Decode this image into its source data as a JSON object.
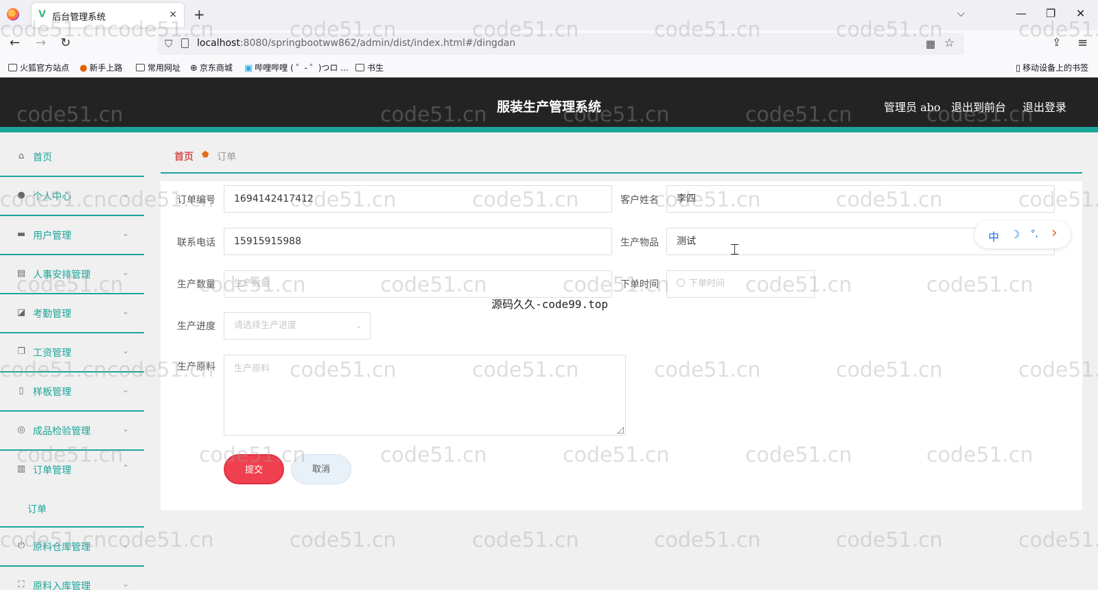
{
  "browser": {
    "tab_title": "后台管理系统",
    "tab_close": "×",
    "new_tab": "+",
    "url_host": "localhost",
    "url_rest": ":8080/springbootww862/admin/dist/index.html#/dingdan",
    "bookmarks": [
      "火狐官方站点",
      "新手上路",
      "常用网址",
      "京东商城",
      "哔哩哔哩 ( ゜- ゜)つロ ...",
      "书生"
    ],
    "mobile_bookmarks": "移动设备上的书签"
  },
  "header": {
    "title": "服装生产管理系统",
    "user": "管理员 abo",
    "to_front": "退出到前台",
    "logout": "退出登录"
  },
  "sidebar": {
    "items": [
      {
        "label": "首页",
        "icon": "home-icon"
      },
      {
        "label": "个人中心",
        "icon": "user-icon"
      },
      {
        "label": "用户管理",
        "icon": "briefcase-icon"
      },
      {
        "label": "人事安排管理",
        "icon": "clipboard-icon"
      },
      {
        "label": "考勤管理",
        "icon": "chart-icon"
      },
      {
        "label": "工资管理",
        "icon": "copy-icon"
      },
      {
        "label": "样板管理",
        "icon": "phone-icon"
      },
      {
        "label": "成品检验管理",
        "icon": "compass-icon"
      },
      {
        "label": "订单管理",
        "icon": "book-icon"
      },
      {
        "label": "原料仓库管理",
        "icon": "power-icon"
      },
      {
        "label": "原料入库管理",
        "icon": "fullscreen-icon"
      }
    ],
    "sub_item": "订单"
  },
  "breadcrumb": {
    "home": "首页",
    "current": "订单"
  },
  "form": {
    "order_no_label": "订单编号",
    "order_no_value": "1694142417412",
    "customer_label": "客户姓名",
    "customer_value": "李四",
    "phone_label": "联系电话",
    "phone_value": "15915915988",
    "goods_label": "生产物品",
    "goods_value": "测试",
    "quantity_label": "生产数量",
    "quantity_placeholder": "生产数量",
    "order_time_label": "下单时间",
    "order_time_placeholder": "下单时间",
    "progress_label": "生产进度",
    "progress_placeholder": "请选择生产进度",
    "material_label": "生产原料",
    "material_placeholder": "生产原料",
    "submit": "提交",
    "cancel": "取消"
  },
  "ime": {
    "zh": "中",
    "moon": "☽",
    "dots": "°,",
    "arrow": "›"
  },
  "overlay": "源码久久-code99.top",
  "watermark": "code51.cn",
  "colors": {
    "accent": "#1aa59a",
    "header_bg": "#232323",
    "submit": "#f0404f",
    "breadcrumb_home": "#d9534f"
  }
}
